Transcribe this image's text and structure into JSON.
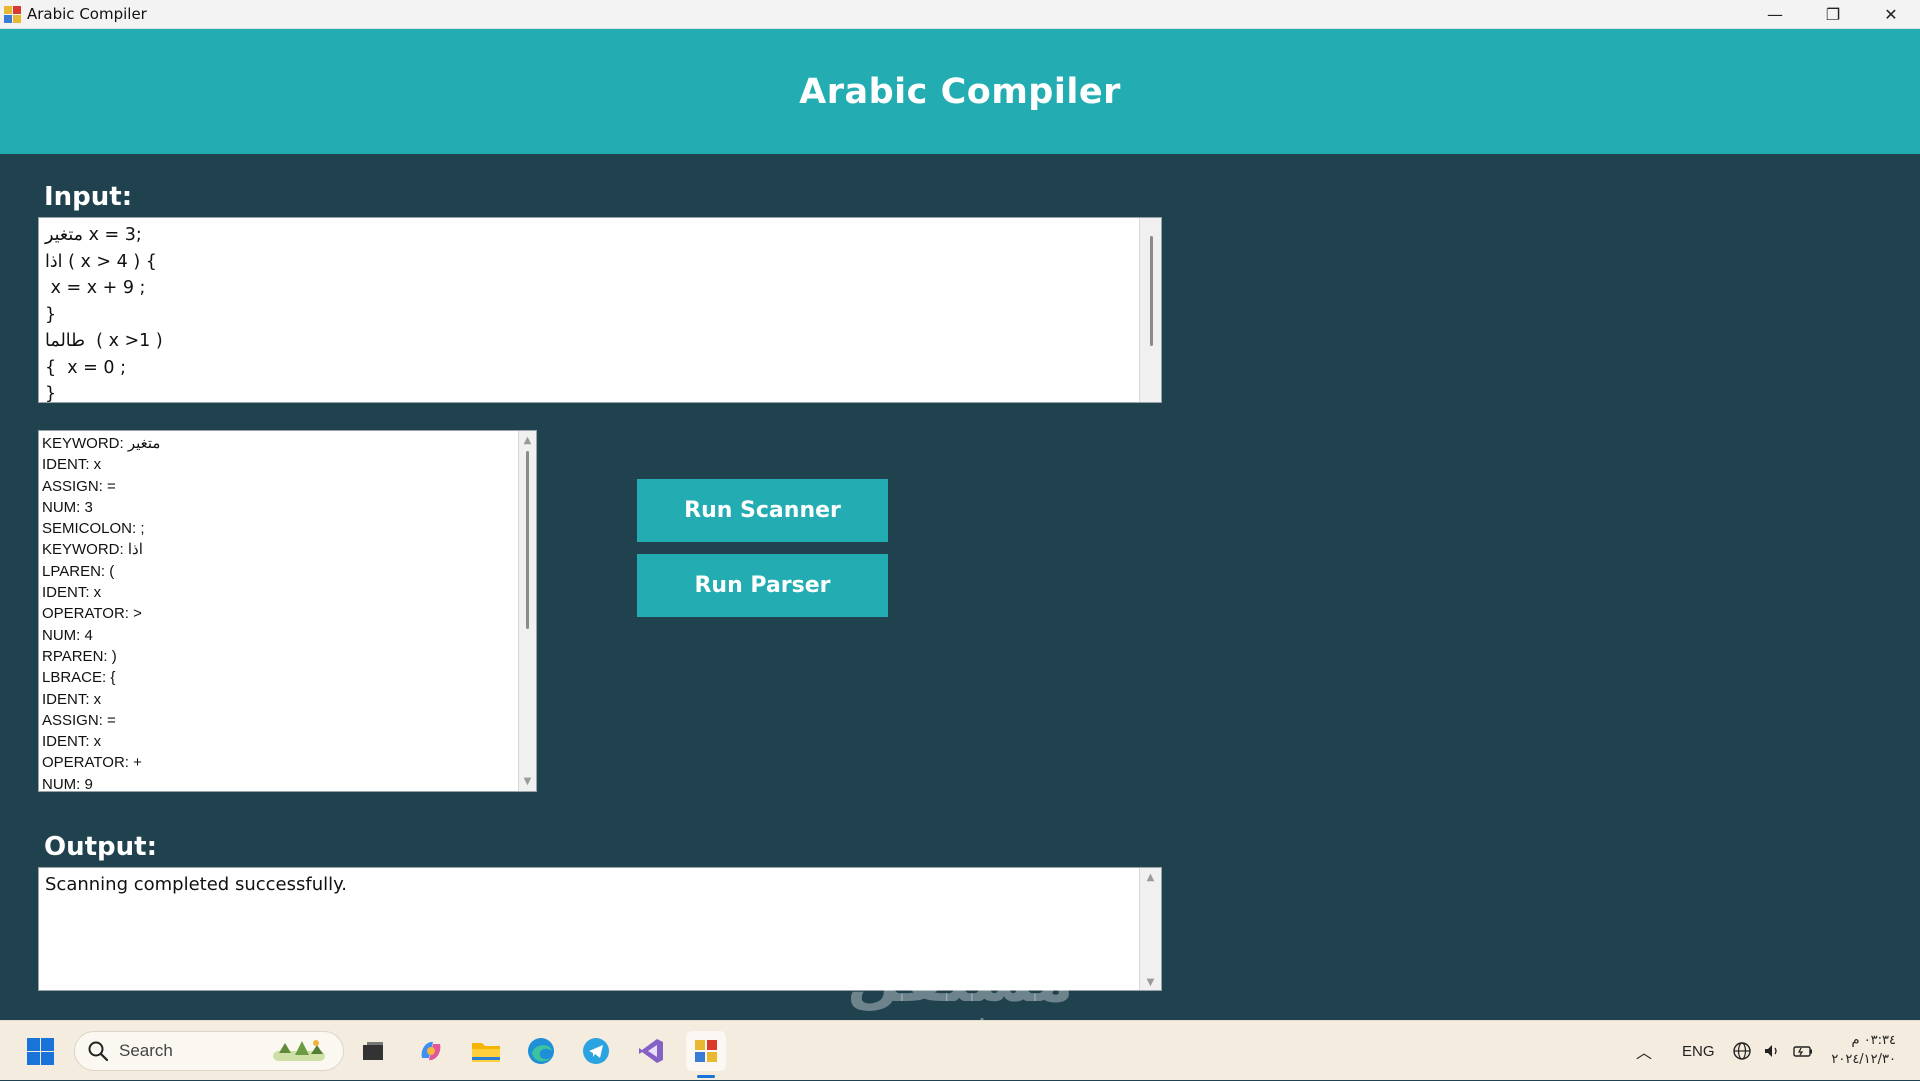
{
  "window": {
    "title": "Arabic Compiler",
    "minimize": "—",
    "restore": "❐",
    "close": "✕"
  },
  "header": {
    "title": "Arabic Compiler"
  },
  "input": {
    "label": "Input:",
    "code": "متغير x = 3;\nاذا ( x > 4 ) {\n x = x + 9 ;\n}\nطالما  ( x >1 )\n{  x = 0 ;\n}"
  },
  "tokens": [
    "KEYWORD: متغير",
    "IDENT: x",
    "ASSIGN: =",
    "NUM: 3",
    "SEMICOLON: ;",
    "KEYWORD: اذا",
    "LPAREN: (",
    "IDENT: x",
    "OPERATOR: >",
    "NUM: 4",
    "RPAREN: )",
    "LBRACE: {",
    "IDENT: x",
    "ASSIGN: =",
    "IDENT: x",
    "OPERATOR: +",
    "NUM: 9"
  ],
  "buttons": {
    "run_scanner": "Run Scanner",
    "run_parser": "Run Parser"
  },
  "output": {
    "label": "Output:",
    "text": "Scanning completed successfully."
  },
  "watermark": {
    "arabic": "مستقل",
    "latin": "mostaql.com"
  },
  "taskbar": {
    "search_placeholder": "Search",
    "language": "ENG",
    "time": "٠٣:٣٤ م",
    "date": "٢٠٢٤/١٢/٣٠",
    "icons": [
      "windows-start-icon",
      "search-icon",
      "task-view-icon",
      "copilot-icon",
      "file-explorer-icon",
      "edge-icon",
      "telegram-icon",
      "visual-studio-icon",
      "arabic-compiler-app-icon"
    ]
  },
  "colors": {
    "header": "#23adb2",
    "background": "#20424f",
    "button": "#23adb2",
    "taskbar": "#f4ecdf"
  }
}
